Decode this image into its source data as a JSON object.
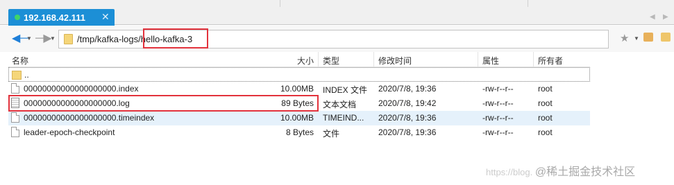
{
  "tab": {
    "title": "192.168.42.111",
    "close": "✕",
    "status_color": "#3fd46a"
  },
  "address": {
    "path": "/tmp/kafka-logs/hello-kafka-3"
  },
  "columns": {
    "name": "名称",
    "size": "大小",
    "type": "类型",
    "modified": "修改时间",
    "attrs": "属性",
    "owner": "所有者"
  },
  "rows": [
    {
      "name": "..",
      "size": "",
      "type": "",
      "modified": "",
      "attrs": "",
      "owner": "",
      "icon": "folder-icon"
    },
    {
      "name": "00000000000000000000.index",
      "size": "10.00MB",
      "type": "INDEX 文件",
      "modified": "2020/7/8, 19:36",
      "attrs": "-rw-r--r--",
      "owner": "root",
      "icon": "file-icon"
    },
    {
      "name": "00000000000000000000.log",
      "size": "89 Bytes",
      "type": "文本文档",
      "modified": "2020/7/8, 19:42",
      "attrs": "-rw-r--r--",
      "owner": "root",
      "icon": "text-file-icon"
    },
    {
      "name": "00000000000000000000.timeindex",
      "size": "10.00MB",
      "type": "TIMEIND...",
      "modified": "2020/7/8, 19:36",
      "attrs": "-rw-r--r--",
      "owner": "root",
      "icon": "file-icon"
    },
    {
      "name": "leader-epoch-checkpoint",
      "size": "8 Bytes",
      "type": "文件",
      "modified": "2020/7/8, 19:36",
      "attrs": "-rw-r--r--",
      "owner": "root",
      "icon": "file-icon"
    }
  ],
  "watermark": {
    "prefix": "https://blog.",
    "brand": "@稀土掘金技术社区"
  },
  "colors": {
    "tab_bg": "#1c8fd6",
    "highlight": "#e2323c",
    "selected_row": "#e5f1fb"
  }
}
